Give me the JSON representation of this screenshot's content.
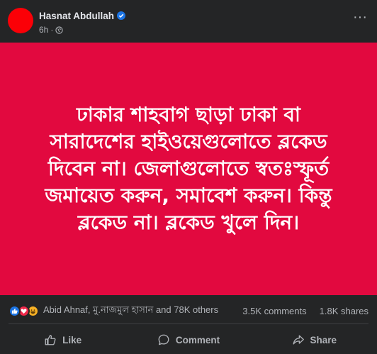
{
  "post": {
    "author": "Hasnat Abdullah",
    "time": "6h",
    "separator": "·",
    "text": "ঢাকার শাহবাগ ছাড়া ঢাকা বা\nসারাদেশের হাইওয়েগুলোতে ব্লকেড\nদিবেন না। জেলাগুলোতে স্বতঃস্ফূর্ত\nজমায়েত করুন, সমাবেশ করুন। কিন্তু\nব্লকেড না। ব্লকেড খুলে দিন।"
  },
  "colors": {
    "post_background": "#e2093f",
    "avatar": "#fb0007",
    "verified": "#1b74e4"
  },
  "icons": [
    "verified-badge-icon",
    "globe-icon",
    "more-options-icon",
    "like-reaction-icon",
    "love-reaction-icon",
    "haha-reaction-icon",
    "like-icon",
    "comment-icon",
    "share-icon"
  ],
  "stats": {
    "reactors": "Abid Ahnaf, মু.নাজমুল হাসান and 78K others",
    "comments": "3.5K comments",
    "shares": "1.8K shares"
  },
  "actions": {
    "like": "Like",
    "comment": "Comment",
    "share": "Share"
  }
}
